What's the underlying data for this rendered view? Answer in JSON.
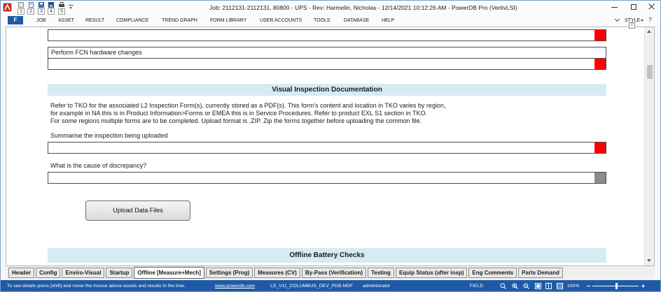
{
  "window": {
    "title": "Job: 2112131-2112131, 80800 - UPS - Rev: Harmelin, Nicholas - 12/14/2021 10:12:26 AM - PowerDB Pro (VertivLSI)",
    "quick_access": [
      "1",
      "2",
      "3",
      "4",
      "5"
    ]
  },
  "menu": {
    "file_label": "F",
    "items": [
      "JOB",
      "ASSET",
      "RESULT",
      "COMPLIANCE",
      "TREND GRAPH",
      "FORM LIBRARY",
      "USER ACCOUNTS",
      "TOOLS",
      "DATABASE",
      "HELP"
    ],
    "style_label": "STYLE",
    "style_keytip": "T",
    "help_glyph": "?"
  },
  "form": {
    "top_field": {
      "value": "",
      "indicator_color": "#ff0000"
    },
    "fcn_changes": {
      "label": "Perform FCN hardware changes",
      "value": "",
      "indicator_color": "#ff0000"
    },
    "visual_inspection": {
      "title": "Visual Inspection Documentation",
      "instructions": [
        "Refer to TKO for the associated L2 Inspection Form(s), currently stored as a PDF(s). This form's content and location in TKO varies by region,",
        "for example in NA this is in Product Information>Forms or EMEA this is in Service Procedures. Refer to product EXL S1 section in TKO.",
        "For some regions multiple forms are to be completed. Upload format is .ZIP. Zip the forms together before uploading the common file."
      ],
      "summary": {
        "label": "Summarise the inspection being uploaded",
        "value": "",
        "indicator_color": "#ff0000"
      },
      "discrepancy": {
        "label": "What is the cause of discrepancy?",
        "value": "",
        "indicator_color": "#8c8c8c"
      },
      "upload_button": "Upload Data Files"
    },
    "offline_battery": {
      "title": "Offline Battery Checks"
    }
  },
  "tabs": {
    "items": [
      "Header",
      "Config",
      "Enviro-Visual",
      "Startup",
      "Offline [Measure+Mech]",
      "Settings (Prog)",
      "Measures (CV)",
      "By-Pass (Verification)",
      "Testing",
      "Equip Status (after insp)",
      "Eng Comments",
      "Parts Demand"
    ],
    "selected_index": 4
  },
  "status_bar": {
    "hint": "To see details press [shift] and move the mouse above assets and results in the tree.",
    "website": "www.powerdb.com",
    "database": "LS_V11_COLUMBUS_DEV_PDB.MDF",
    "user": "administrator",
    "mode": "FIELD",
    "zoom": "100%"
  },
  "colors": {
    "brand_blue": "#1f5aa6",
    "section_header": "#d6ebf4",
    "required_indicator": "#ff0000",
    "inactive_indicator": "#8c8c8c"
  },
  "icons": {
    "app": "powerdb-logo-icon",
    "quick_access": [
      "new-icon",
      "open-icon",
      "save-icon",
      "save-all-icon",
      "print-icon"
    ],
    "window": [
      "minimize-icon",
      "maximize-icon",
      "close-icon"
    ],
    "status": [
      "zoom-fit-icon",
      "zoom-in-icon",
      "zoom-out-icon",
      "normal-view-icon",
      "layout-view-icon",
      "full-view-icon"
    ]
  }
}
